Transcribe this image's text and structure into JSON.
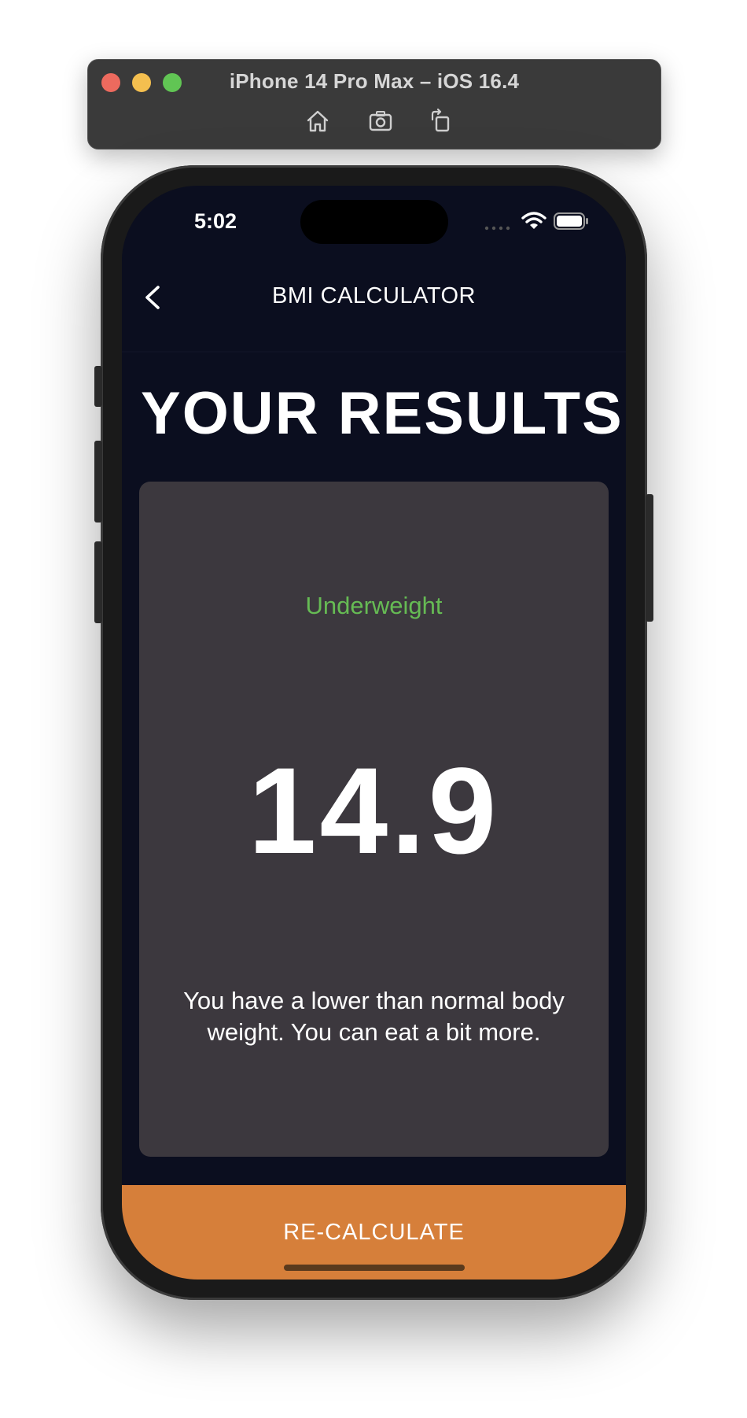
{
  "simulator": {
    "title": "iPhone 14 Pro Max – iOS 16.4",
    "tools": [
      "home-icon",
      "screenshot-icon",
      "rotate-icon"
    ]
  },
  "status_bar": {
    "time": "5:02",
    "icons": [
      "cellular-icon",
      "wifi-icon",
      "battery-icon"
    ]
  },
  "nav": {
    "title": "BMI CALCULATOR",
    "back_icon": "chevron-left-icon"
  },
  "page": {
    "heading": "YOUR RESULTS"
  },
  "result": {
    "category": "Underweight",
    "value": "14.9",
    "interpretation": "You have a lower than normal body weight. You can eat a bit more."
  },
  "action": {
    "label": "RE-CALCULATE"
  },
  "colors": {
    "background": "#0b0e1f",
    "card": "#3c383e",
    "category_text": "#66bb54",
    "button": "#d67f3a"
  }
}
